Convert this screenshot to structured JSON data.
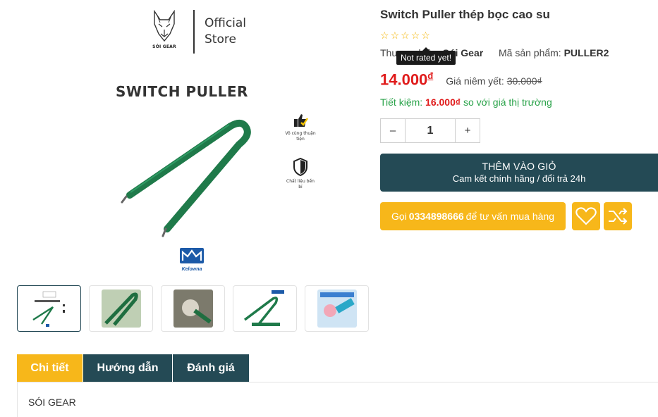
{
  "gallery": {
    "store_line1": "Official",
    "store_line2": "Store",
    "brand_caption": "SÓI GEAR",
    "image_heading": "SWITCH PULLER",
    "feature1": "Vô cùng thuận tiện",
    "feature2": "Chất liệu bền bỉ",
    "maker_logo": "Kelowna",
    "thumbnail_count": 5
  },
  "product": {
    "title": "Switch Puller thép bọc cao su",
    "rating_tooltip": "Not rated yet!",
    "rating_stars": 5,
    "brand_label": "Thương hiệu:",
    "brand_value": "Sói Gear",
    "sku_label": "Mã sản phẩm:",
    "sku_value": "PULLER2",
    "price": "14.000",
    "currency": "đ",
    "list_price_label": "Giá niêm yết:",
    "list_price": "30.000₫",
    "saving_prefix": "Tiết kiệm:",
    "saving_value": "16.000₫",
    "saving_suffix": "so với giá thị trường",
    "quantity": "1",
    "qty_minus": "–",
    "qty_plus": "+"
  },
  "actions": {
    "add_to_cart": "THÊM VÀO GIỎ",
    "add_to_cart_sub": "Cam kết chính hãng / đổi trả 24h",
    "call_prefix": "Gọi",
    "call_phone": "0334898666",
    "call_suffix": "để tư vấn mua hàng",
    "wishlist_icon": "heart-icon",
    "compare_icon": "shuffle-icon"
  },
  "tabs": [
    {
      "label": "Chi tiết",
      "active": true
    },
    {
      "label": "Hướng dẫn",
      "active": false
    },
    {
      "label": "Đánh giá",
      "active": false
    }
  ],
  "tab_content": "SÓI GEAR",
  "colors": {
    "accent_yellow": "#f7b71a",
    "dark_teal": "#244a55",
    "price_red": "#e01b1b",
    "saving_green": "#2aa34a",
    "tool_green": "#1f7a4a"
  }
}
